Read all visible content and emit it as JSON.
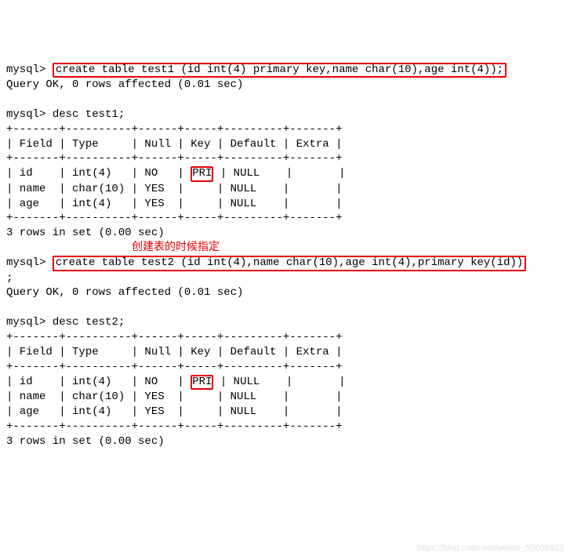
{
  "prompt": "mysql>",
  "cmds": {
    "create1": "create table test1 (id int(4) primary key,name char(10),age int(4));",
    "query_ok1": "Query OK, 0 rows affected (0.01 sec)",
    "desc1": " desc test1;",
    "create2": "create table test2 (id int(4),name char(10),age int(4),primary key(id))",
    "semicolon": ";",
    "query_ok2": "Query OK, 0 rows affected (0.01 sec)",
    "desc2": " desc test2;"
  },
  "border": {
    "top": "+-------+----------+------+-----+---------+-------+",
    "header": "| Field | Type     | Null | Key | Default | Extra |",
    "r_id_pre": "| id    | int(4)   | NO   | ",
    "r_id_key": "PRI",
    "r_id_post": " | NULL    |       |",
    "r_name": "| name  | char(10) | YES  |     | NULL    |       |",
    "r_age": "| age   | int(4)   | YES  |     | NULL    |       |"
  },
  "rows_msg": "3 rows in set (0.00 sec)",
  "annotation": "创建表的时候指定",
  "watermark": "https://blog.csdn.net/weixin_55609823",
  "chart_data": [
    {
      "type": "table",
      "title": "desc test1",
      "columns": [
        "Field",
        "Type",
        "Null",
        "Key",
        "Default",
        "Extra"
      ],
      "rows": [
        [
          "id",
          "int(4)",
          "NO",
          "PRI",
          "NULL",
          ""
        ],
        [
          "name",
          "char(10)",
          "YES",
          "",
          "NULL",
          ""
        ],
        [
          "age",
          "int(4)",
          "YES",
          "",
          "NULL",
          ""
        ]
      ]
    },
    {
      "type": "table",
      "title": "desc test2",
      "columns": [
        "Field",
        "Type",
        "Null",
        "Key",
        "Default",
        "Extra"
      ],
      "rows": [
        [
          "id",
          "int(4)",
          "NO",
          "PRI",
          "NULL",
          ""
        ],
        [
          "name",
          "char(10)",
          "YES",
          "",
          "NULL",
          ""
        ],
        [
          "age",
          "int(4)",
          "YES",
          "",
          "NULL",
          ""
        ]
      ]
    }
  ]
}
